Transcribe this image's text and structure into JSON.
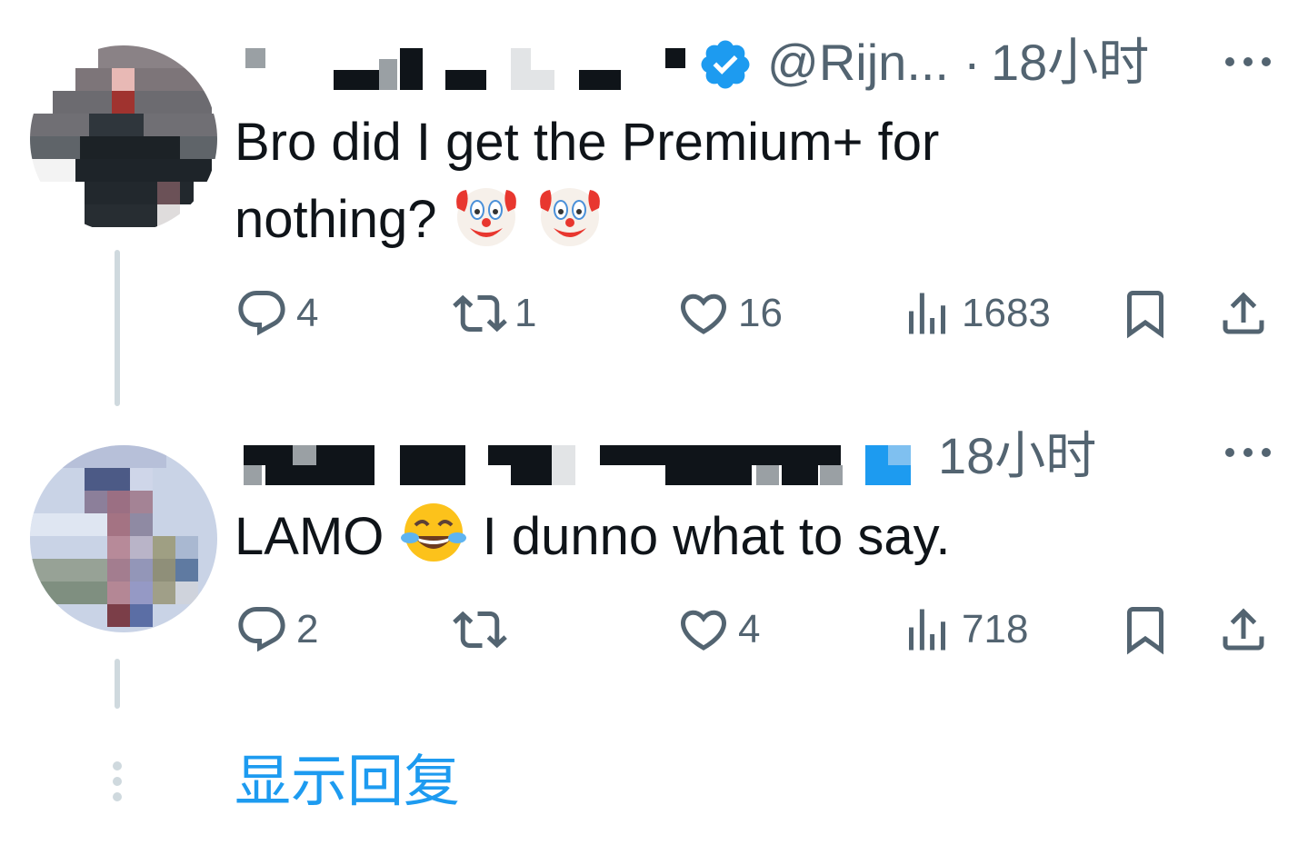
{
  "colors": {
    "text_primary": "#0f1419",
    "text_secondary": "#536471",
    "accent": "#1d9bf0",
    "thread_line": "#cfd9de",
    "verified_badge": "#1d9bf0"
  },
  "tweets": [
    {
      "handle": "@Rijn...",
      "separator": "·",
      "time": "18小时",
      "verified": true,
      "text_before_emoji": "Bro did I get the Premium+ for nothing?",
      "emojis": [
        "clown-face",
        "clown-face"
      ],
      "stats": {
        "replies": "4",
        "retweets": "1",
        "likes": "16",
        "views": "1683"
      },
      "icons": {
        "reply": "reply-icon",
        "retweet": "retweet-icon",
        "like": "heart-icon",
        "views": "views-chart-icon",
        "bookmark": "bookmark-icon",
        "share": "share-icon",
        "more": "more-icon",
        "verified": "verified-badge-icon"
      }
    },
    {
      "time": "18小时",
      "text_before_emoji": "LAMO",
      "emoji": "face-with-tears-of-joy",
      "text_after_emoji": "I dunno what to say.",
      "stats": {
        "replies": "2",
        "retweets": "",
        "likes": "4",
        "views": "718"
      }
    }
  ],
  "show_replies_label": "显示回复"
}
